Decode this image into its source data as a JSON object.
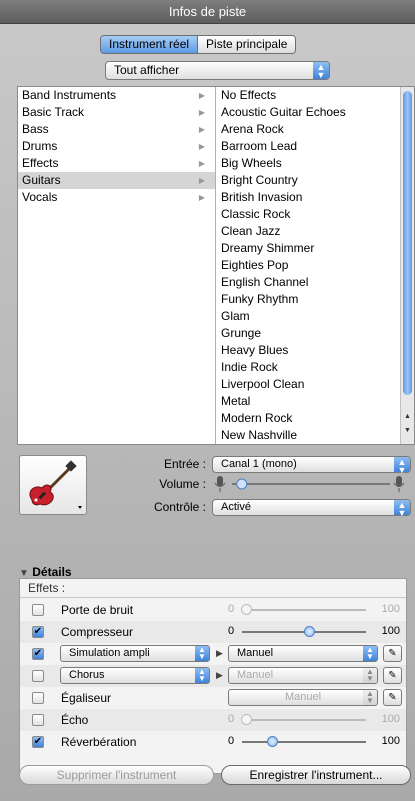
{
  "window": {
    "title": "Infos de piste"
  },
  "tabs": [
    {
      "label": "Instrument réel",
      "active": true
    },
    {
      "label": "Piste principale",
      "active": false
    }
  ],
  "filter": {
    "value": "Tout afficher"
  },
  "categories": [
    "Band Instruments",
    "Basic Track",
    "Bass",
    "Drums",
    "Effects",
    "Guitars",
    "Vocals"
  ],
  "selected_category": "Guitars",
  "presets": [
    "No Effects",
    "Acoustic Guitar Echoes",
    "Arena Rock",
    "Barroom Lead",
    "Big Wheels",
    "Bright Country",
    "British Invasion",
    "Classic Rock",
    "Clean Jazz",
    "Dreamy Shimmer",
    "Eighties Pop",
    "English Channel",
    "Funky Rhythm",
    "Glam",
    "Grunge",
    "Heavy Blues",
    "Indie Rock",
    "Liverpool Clean",
    "Metal",
    "Modern Rock",
    "New Nashville"
  ],
  "input": {
    "label": "Entrée :",
    "value": "Canal 1 (mono)"
  },
  "volume": {
    "label": "Volume :",
    "level": 0.03
  },
  "monitor": {
    "label": "Contrôle :",
    "value": "Activé"
  },
  "details": {
    "label": "Détails"
  },
  "effects": {
    "header": "Effets :",
    "rows": [
      {
        "name": "Porte de bruit",
        "checked": false,
        "min": "0",
        "max": "100",
        "level": 0.04
      },
      {
        "name": "Compresseur",
        "checked": true,
        "min": "0",
        "max": "100",
        "level": 0.55
      },
      {
        "name": "Simulation ampli",
        "checked": true,
        "preset": "Manuel"
      },
      {
        "name": "Chorus",
        "checked": false,
        "preset": "Manuel"
      },
      {
        "name": "Égaliseur",
        "checked": false,
        "preset": "Manuel"
      },
      {
        "name": "Écho",
        "checked": false,
        "min": "0",
        "max": "100",
        "level": 0.04
      },
      {
        "name": "Réverbération",
        "checked": true,
        "min": "0",
        "max": "100",
        "level": 0.25
      }
    ]
  },
  "buttons": {
    "delete": "Supprimer l'instrument",
    "save": "Enregistrer l'instrument..."
  },
  "icons": {
    "instrument": "electric-guitar-icon"
  }
}
